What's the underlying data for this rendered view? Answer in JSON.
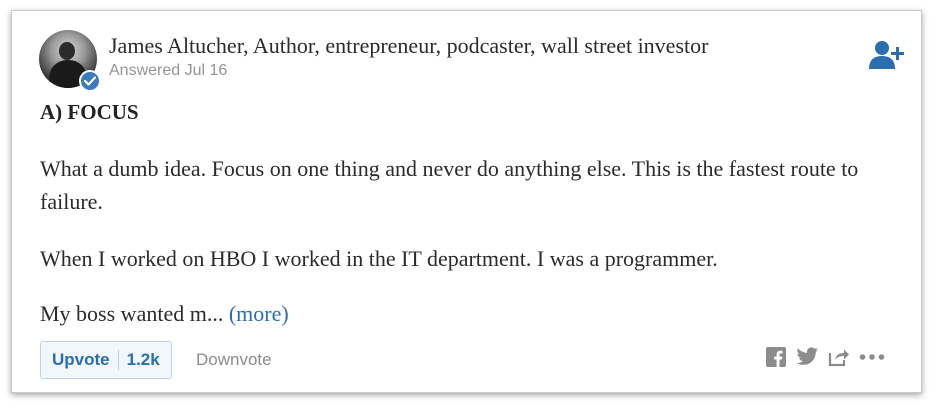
{
  "author": {
    "name_line": "James Altucher, Author, entrepreneur, podcaster, wall street investor",
    "answered": "Answered Jul 16"
  },
  "answer": {
    "heading": "A) FOCUS",
    "paragraphs": [
      "What a dumb idea. Focus on one thing and never do anything else. This is the fastest route to failure.",
      "When I worked on HBO I worked in the IT department. I was a programmer."
    ],
    "truncated_text": "My boss wanted m...",
    "more_label": "(more)"
  },
  "actions": {
    "upvote_label": "Upvote",
    "upvote_count": "1.2k",
    "downvote_label": "Downvote"
  },
  "colors": {
    "accent": "#2b6dad",
    "verified_badge": "#3b7bbf",
    "icon_gray": "#8c8c8c"
  },
  "icons": [
    "verified-check-icon",
    "follow-user-plus-icon",
    "facebook-icon",
    "twitter-icon",
    "share-icon",
    "more-options-icon"
  ]
}
